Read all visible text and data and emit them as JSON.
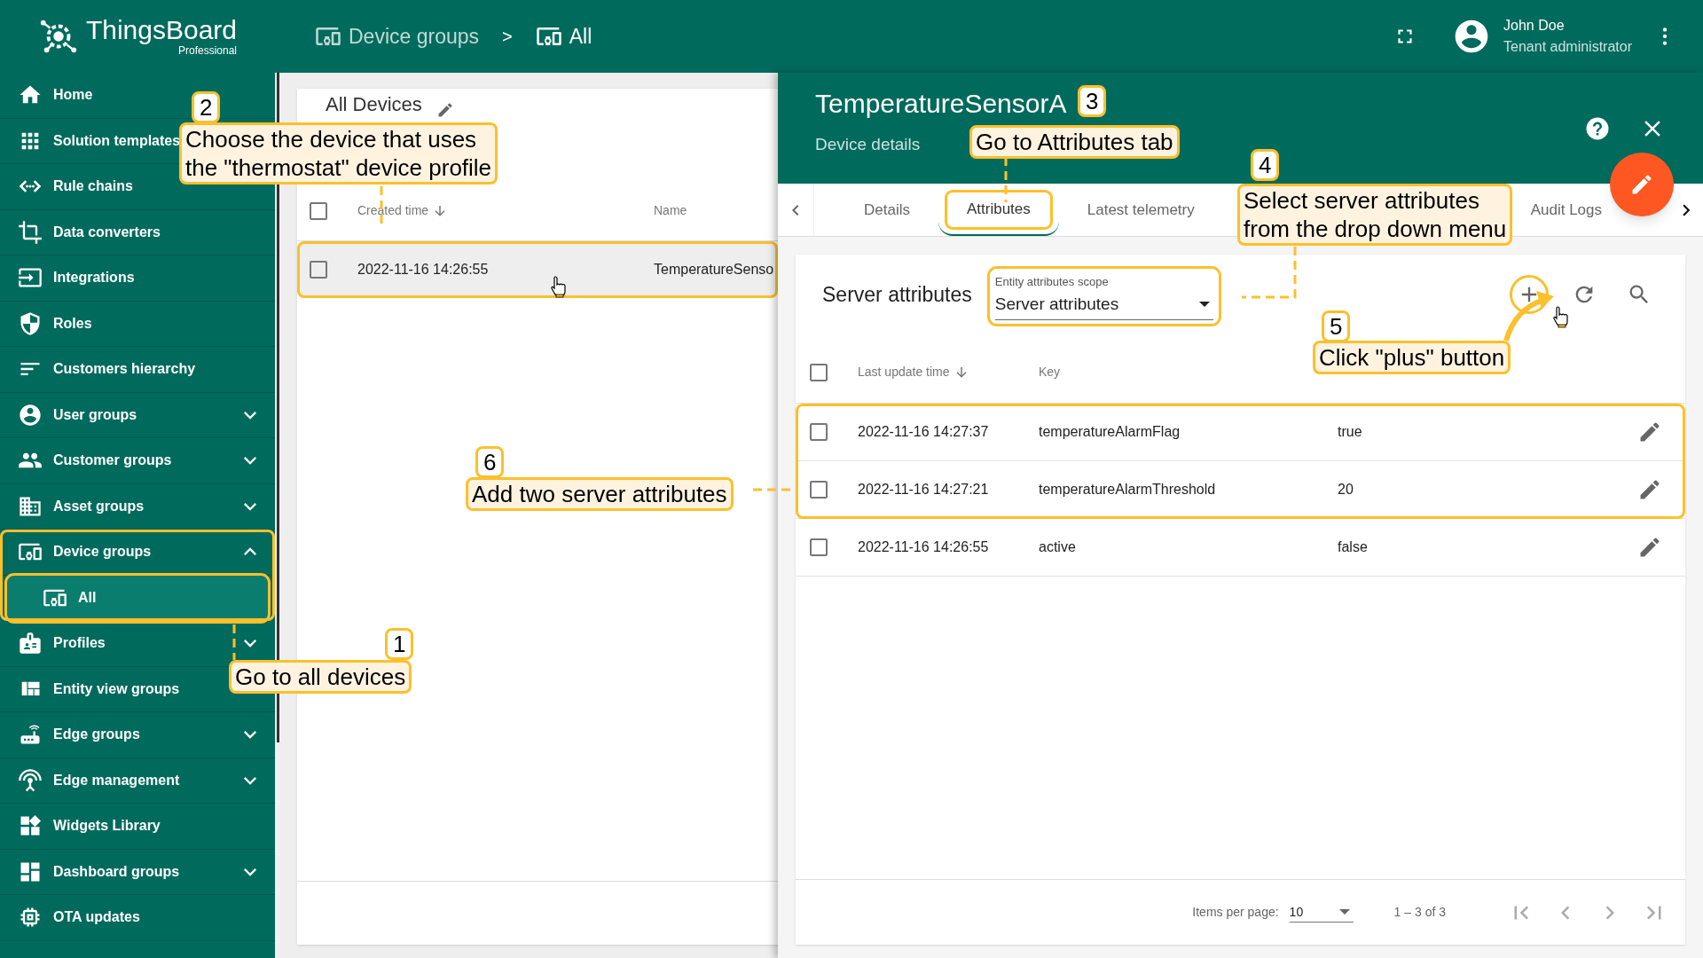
{
  "header": {
    "logo_title": "ThingsBoard",
    "logo_subtitle": "Professional",
    "breadcrumb": [
      "Device groups",
      "All"
    ],
    "separator": ">",
    "user": {
      "name": "John Doe",
      "role": "Tenant administrator"
    }
  },
  "sidebar": {
    "items": [
      {
        "label": "Home"
      },
      {
        "label": "Solution templates"
      },
      {
        "label": "Rule chains"
      },
      {
        "label": "Data converters"
      },
      {
        "label": "Integrations"
      },
      {
        "label": "Roles"
      },
      {
        "label": "Customers hierarchy"
      },
      {
        "label": "User groups",
        "expanded": false
      },
      {
        "label": "Customer groups",
        "expanded": false
      },
      {
        "label": "Asset groups",
        "expanded": false
      },
      {
        "label": "Device groups",
        "expanded": true,
        "highlighted": true,
        "children": [
          {
            "label": "All",
            "selected": true,
            "highlighted": true
          }
        ]
      },
      {
        "label": "Profiles",
        "expanded": false
      },
      {
        "label": "Entity view groups"
      },
      {
        "label": "Edge groups",
        "expanded": false
      },
      {
        "label": "Edge management",
        "expanded": false
      },
      {
        "label": "Widgets Library"
      },
      {
        "label": "Dashboard groups",
        "expanded": false
      },
      {
        "label": "OTA updates"
      }
    ]
  },
  "device_list": {
    "title": "All Devices",
    "columns": [
      "Created time",
      "Name"
    ],
    "all_checked": false,
    "rows": [
      {
        "created": "2022-11-16 14:26:55",
        "name": "TemperatureSenso",
        "checked": false,
        "highlighted": true
      }
    ]
  },
  "details": {
    "title": "TemperatureSensorA",
    "subtitle": "Device details",
    "tabs": [
      {
        "label": "Details",
        "selected": false,
        "highlighted": false
      },
      {
        "label": "Attributes",
        "selected": true,
        "highlighted": true
      },
      {
        "label": "Latest telemetry",
        "selected": false,
        "highlighted": false
      },
      {
        "label": "Audit Logs",
        "selected": false,
        "highlighted": false
      }
    ],
    "attributes": {
      "title": "Server attributes",
      "scope": {
        "label": "Entity attributes scope",
        "value": "Server attributes",
        "highlighted": true
      },
      "actions": [
        {
          "kind": "add",
          "highlighted": true
        },
        {
          "kind": "refresh"
        },
        {
          "kind": "search"
        }
      ],
      "columns": [
        "Last update time",
        "Key"
      ],
      "all_checked": false,
      "rows": [
        {
          "time": "2022-11-16 14:27:37",
          "key": "temperatureAlarmFlag",
          "value": "true",
          "checked": false,
          "highlighted": true
        },
        {
          "time": "2022-11-16 14:27:21",
          "key": "temperatureAlarmThreshold",
          "value": "20",
          "checked": false,
          "highlighted": true
        },
        {
          "time": "2022-11-16 14:26:55",
          "key": "active",
          "value": "false",
          "checked": false,
          "highlighted": false
        }
      ],
      "paginator": {
        "label": "Items per page:",
        "page_size": "10",
        "range": "1 – 3 of 3"
      }
    }
  },
  "callouts": [
    {
      "number": "2",
      "lines": [
        "Choose the device that uses",
        "the \"thermostat\" device profile"
      ]
    },
    {
      "number": "3",
      "lines": [
        "Go to Attributes tab"
      ]
    },
    {
      "number": "4",
      "lines": [
        "Select server attributes",
        "from the drop down menu"
      ]
    },
    {
      "number": "5",
      "lines": [
        "Click \"plus\" button"
      ]
    },
    {
      "number": "6",
      "lines": [
        "Add two server attributes"
      ]
    },
    {
      "number": "1",
      "lines": [
        "Go to all devices"
      ]
    }
  ]
}
